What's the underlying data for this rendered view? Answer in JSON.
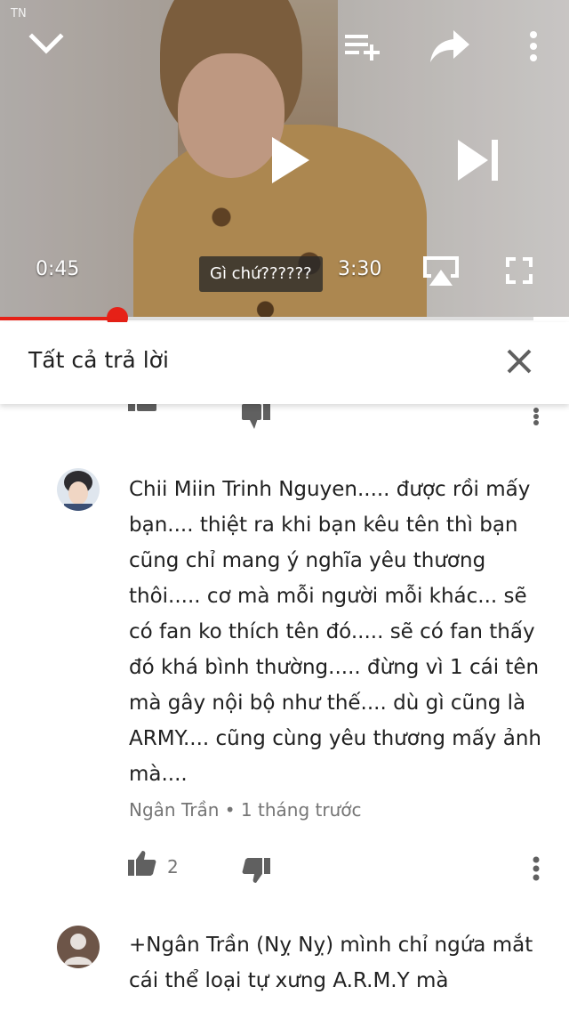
{
  "player": {
    "watermark": "TN",
    "current_time": "0:45",
    "duration": "3:30",
    "caption": "Gì chứ??????",
    "progress": 0.22,
    "icons": {
      "collapse": "chevron-down-icon",
      "add_to_playlist": "playlist-add-icon",
      "share": "share-icon",
      "more": "more-vert-icon",
      "play": "play-icon",
      "next": "skip-next-icon",
      "airplay": "airplay-icon",
      "fullscreen": "fullscreen-icon"
    }
  },
  "replies": {
    "title": "Tất cả trả lời",
    "close_icon": "close-icon"
  },
  "comments": [
    {
      "text": "Chii Miin Trinh Nguyen..... được rồi mấy bạn.... thiệt ra khi bạn kêu tên thì bạn cũng chỉ mang ý nghĩa yêu thương thôi..... cơ mà mỗi người mỗi khác... sẽ có fan ko thích tên đó..... sẽ có fan thấy đó khá bình thường..... đừng vì 1 cái tên mà gây nội bộ như thế.... dù gì cũng là ARMY.... cũng cùng yêu thương mấy ảnh mà....",
      "author": "Ngân Trần",
      "separator": "•",
      "time": "1 tháng trước",
      "likes": "2"
    },
    {
      "text": "+Ngân Trần (Nỵ Nỵ) mình chỉ ngứa mắt cái thể loại tự xưng A.R.M.Y mà"
    }
  ],
  "colors": {
    "accent": "#e62117",
    "text": "#212121",
    "secondary": "#757575",
    "icon": "#606060"
  }
}
